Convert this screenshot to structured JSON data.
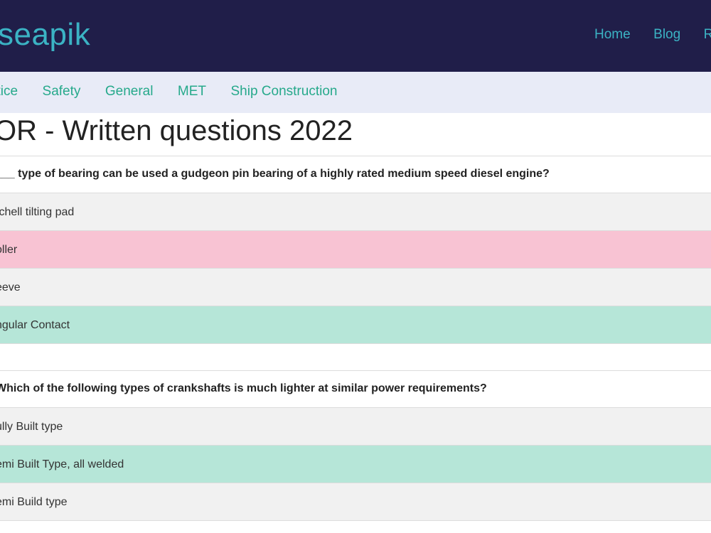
{
  "header": {
    "logo": "seapik",
    "nav": [
      "Home",
      "Blog",
      "Re"
    ]
  },
  "subnav": {
    "items": [
      "ctice",
      "Safety",
      "General",
      "MET",
      "Ship Construction"
    ]
  },
  "page": {
    "title": "OR - Written questions 2022"
  },
  "questions": [
    {
      "text": "___ type of bearing can be used a gudgeon pin bearing of a highly rated medium speed diesel engine?",
      "options": [
        {
          "label": "tchell tilting pad",
          "state": "neutral"
        },
        {
          "label": "oller",
          "state": "incorrect"
        },
        {
          "label": "eeve",
          "state": "neutral"
        },
        {
          "label": "ngular Contact",
          "state": "correct"
        }
      ]
    },
    {
      "text": "Which of the following types of crankshafts is much lighter at similar power requirements?",
      "options": [
        {
          "label": "ully Built type",
          "state": "neutral"
        },
        {
          "label": "emi Built Type, all welded",
          "state": "correct"
        },
        {
          "label": "emi Build type",
          "state": "neutral"
        }
      ]
    }
  ],
  "colors": {
    "header_bg": "#201e49",
    "brand": "#3bb3c4",
    "subnav_bg": "#e8ebf7",
    "subnav_link": "#26a98b",
    "incorrect": "#f8c3d3",
    "correct": "#b6e6d8"
  }
}
